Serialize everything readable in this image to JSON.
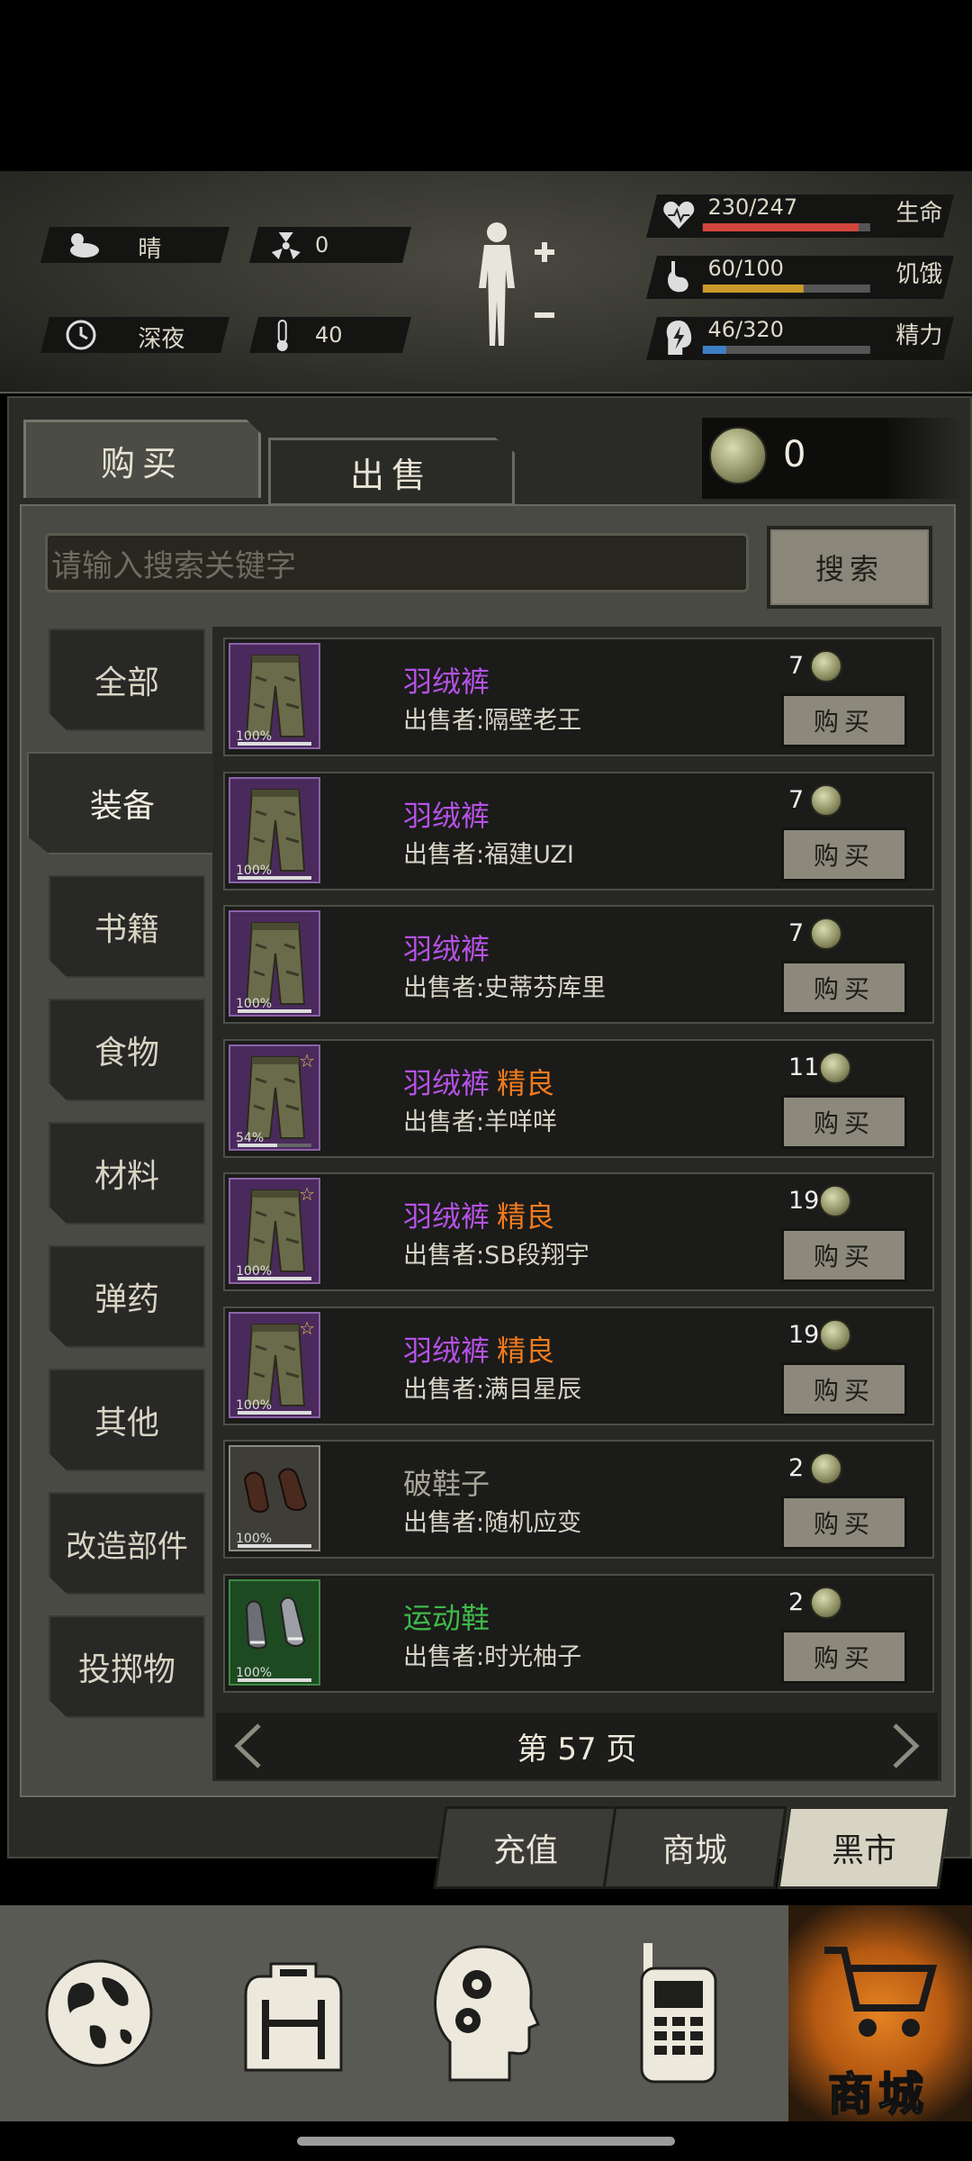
{
  "status": {
    "weather_icon": "cloud-sun-icon",
    "weather": "晴",
    "radiation_icon": "radiation-icon",
    "radiation": "0",
    "time_icon": "clock-icon",
    "time_of_day": "深夜",
    "temp_icon": "thermometer-icon",
    "temperature": "40",
    "bars": [
      {
        "icon": "heart-icon",
        "value": "230/247",
        "label": "生命",
        "fraction": 0.93,
        "color": "#d0463c"
      },
      {
        "icon": "stomach-icon",
        "value": "60/100",
        "label": "饥饿",
        "fraction": 0.6,
        "color": "#c99a2a"
      },
      {
        "icon": "energy-icon",
        "value": "46/320",
        "label": "精力",
        "fraction": 0.14,
        "color": "#3c7fc4"
      }
    ]
  },
  "tabs": {
    "buy": "购买",
    "sell": "出售"
  },
  "balance": "0",
  "search": {
    "placeholder": "请输入搜索关键字",
    "button": "搜索"
  },
  "categories": [
    "全部",
    "装备",
    "书籍",
    "食物",
    "材料",
    "弹药",
    "其他",
    "改造部件",
    "投掷物"
  ],
  "active_category": "装备",
  "seller_prefix": "出售者:",
  "buy_label": "购买",
  "items": [
    {
      "name": "羽绒裤",
      "quality": "",
      "seller": "出售者:隔壁老王",
      "price": "7",
      "durability": "100%",
      "durability_fraction": 1.0,
      "rarity": "purple",
      "icon": "pants-icon",
      "name_color": "#b552e6"
    },
    {
      "name": "羽绒裤",
      "quality": "",
      "seller": "出售者:福建UZI",
      "price": "7",
      "durability": "100%",
      "durability_fraction": 1.0,
      "rarity": "purple",
      "icon": "pants-icon",
      "name_color": "#b552e6"
    },
    {
      "name": "羽绒裤",
      "quality": "",
      "seller": "出售者:史蒂芬库里",
      "price": "7",
      "durability": "100%",
      "durability_fraction": 1.0,
      "rarity": "purple",
      "icon": "pants-icon",
      "name_color": "#b552e6"
    },
    {
      "name": "羽绒裤",
      "quality": "精良",
      "seller": "出售者:羊咩咩",
      "price": "11",
      "durability": "54%",
      "durability_fraction": 0.54,
      "rarity": "purple",
      "icon": "pants-icon",
      "name_color": "#b552e6"
    },
    {
      "name": "羽绒裤",
      "quality": "精良",
      "seller": "出售者:SB段翔宇",
      "price": "19",
      "durability": "100%",
      "durability_fraction": 1.0,
      "rarity": "purple",
      "icon": "pants-icon",
      "name_color": "#b552e6"
    },
    {
      "name": "羽绒裤",
      "quality": "精良",
      "seller": "出售者:满目星辰",
      "price": "19",
      "durability": "100%",
      "durability_fraction": 1.0,
      "rarity": "purple",
      "icon": "pants-icon",
      "name_color": "#b552e6"
    },
    {
      "name": "破鞋子",
      "quality": "",
      "seller": "出售者:随机应变",
      "price": "2",
      "durability": "100%",
      "durability_fraction": 1.0,
      "rarity": "gray",
      "icon": "shoes-icon",
      "name_color": "#a8a59a"
    },
    {
      "name": "运动鞋",
      "quality": "",
      "seller": "出售者:时光柚子",
      "price": "2",
      "durability": "100%",
      "durability_fraction": 1.0,
      "rarity": "green",
      "icon": "sneakers-icon",
      "name_color": "#3fb94a"
    }
  ],
  "pager": {
    "label": "第 57 页"
  },
  "store_tabs": [
    "充值",
    "商城",
    "黑市"
  ],
  "active_store_tab": "黑市",
  "bottom_nav": [
    {
      "icon": "globe-icon",
      "label": ""
    },
    {
      "icon": "backpack-icon",
      "label": ""
    },
    {
      "icon": "head-gears-icon",
      "label": ""
    },
    {
      "icon": "walkie-talkie-icon",
      "label": ""
    },
    {
      "icon": "shopping-cart-icon",
      "label": "商城"
    }
  ]
}
